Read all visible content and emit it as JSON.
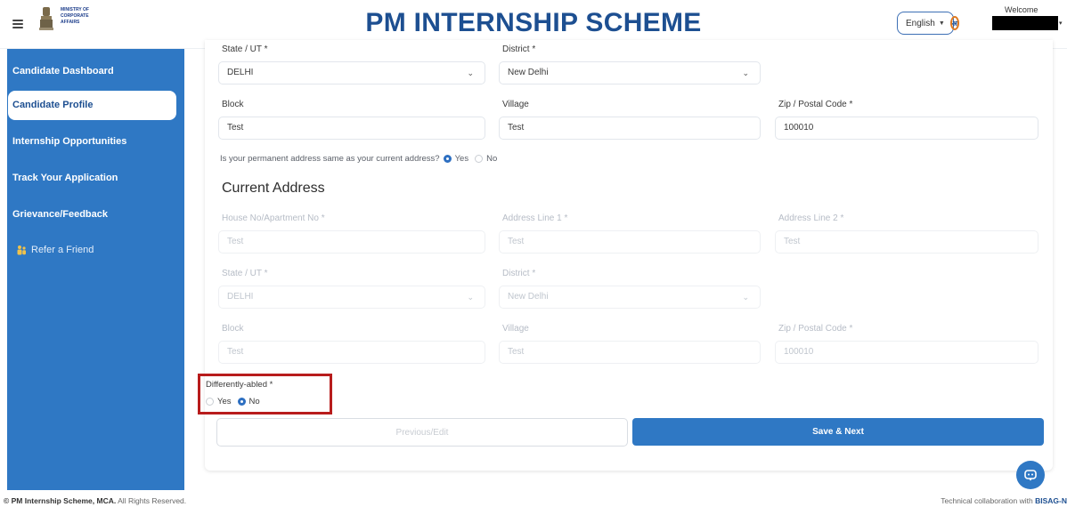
{
  "header": {
    "ministry_line1": "MINISTRY OF",
    "ministry_line2": "CORPORATE",
    "ministry_line3": "AFFAIRS",
    "title": "PM INTERNSHIP SCHEME",
    "language": "English",
    "hindi_glyph": "अ",
    "welcome": "Welcome"
  },
  "sidebar": {
    "items": [
      {
        "label": "Candidate Dashboard"
      },
      {
        "label": "Candidate Profile"
      },
      {
        "label": "Internship Opportunities"
      },
      {
        "label": "Track Your Application"
      },
      {
        "label": "Grievance/Feedback"
      },
      {
        "label": "Refer a Friend"
      }
    ],
    "active_index": 1
  },
  "form": {
    "top": {
      "state_label": "State / UT *",
      "state_value": "DELHI",
      "district_label": "District *",
      "district_value": "New Delhi",
      "block_label": "Block",
      "block_value": "Test",
      "village_label": "Village",
      "village_value": "Test",
      "zip_label": "Zip / Postal Code *",
      "zip_value": "100010"
    },
    "same_address_question": "Is your permanent address same as your current address?",
    "same_address_yes": "Yes",
    "same_address_no": "No",
    "same_address_selected": "Yes",
    "current_address_title": "Current Address",
    "current": {
      "house_label": "House No/Apartment No *",
      "house_value": "Test",
      "line1_label": "Address Line 1 *",
      "line1_value": "Test",
      "line2_label": "Address Line 2 *",
      "line2_value": "Test",
      "state_label": "State / UT *",
      "state_value": "DELHI",
      "district_label": "District *",
      "district_value": "New Delhi",
      "block_label": "Block",
      "block_value": "Test",
      "village_label": "Village",
      "village_value": "Test",
      "zip_label": "Zip / Postal Code *",
      "zip_value": "100010"
    },
    "differently_abled_label": "Differently-abled *",
    "differently_abled_yes": "Yes",
    "differently_abled_no": "No",
    "differently_abled_selected": "No",
    "prev_button": "Previous/Edit",
    "save_button": "Save & Next"
  },
  "footer": {
    "left_prefix": "© PM Internship Scheme, MCA.",
    "left_suffix": "All Rights Reserved.",
    "right_prefix": "Technical collaboration with",
    "right_brand": "BISAG-N"
  },
  "colors": {
    "primary": "#2f78c4",
    "title": "#1d4f91",
    "highlight": "#b81c1c"
  }
}
